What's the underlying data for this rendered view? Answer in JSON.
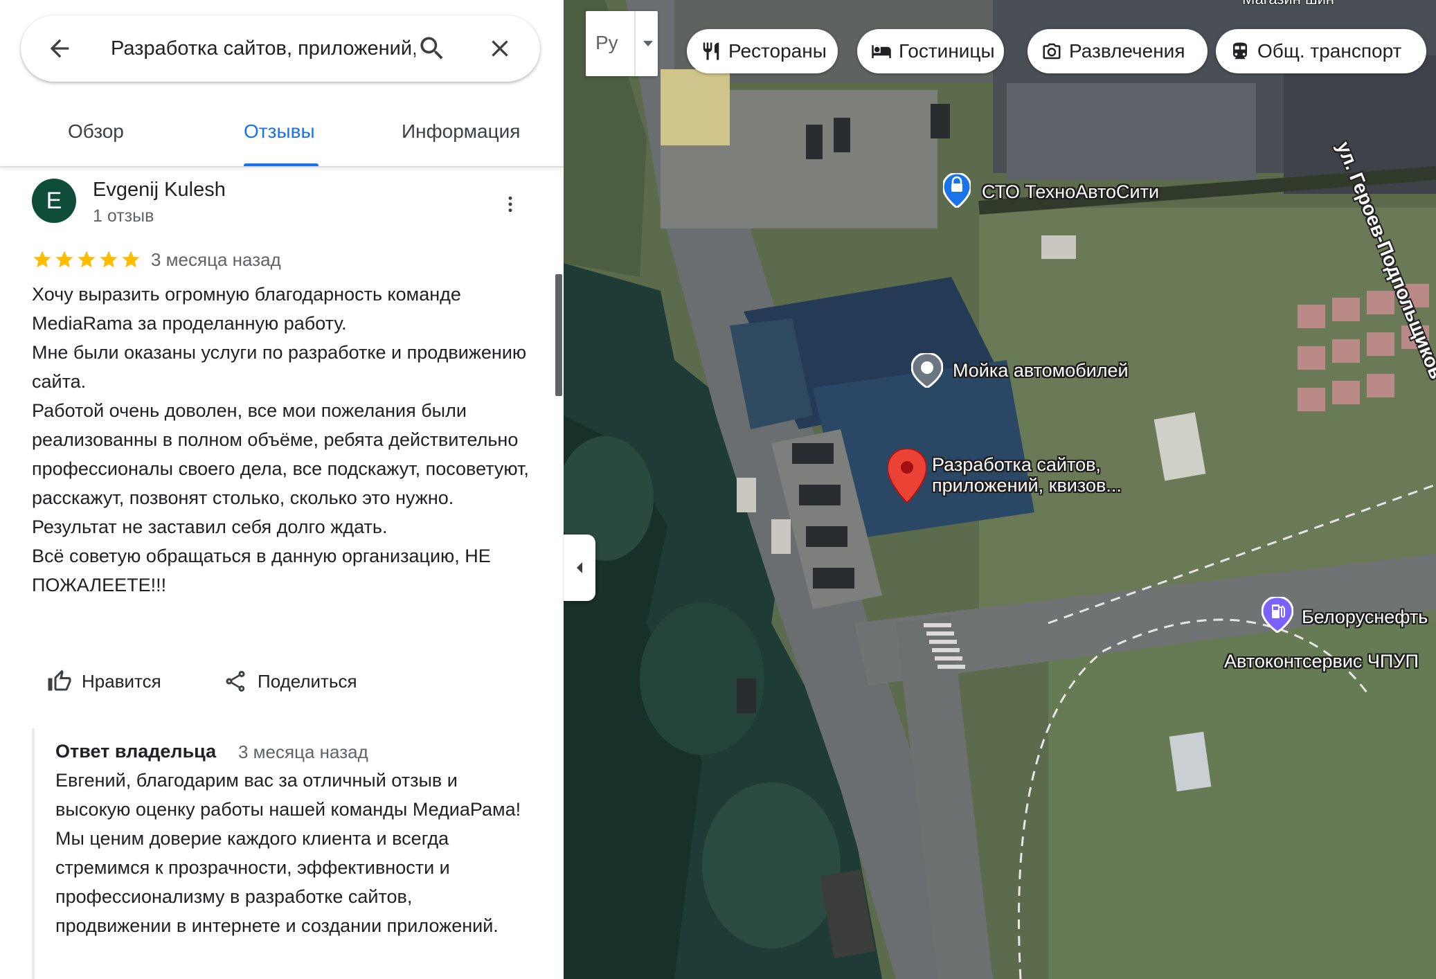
{
  "search": {
    "query": "Разработка сайтов, приложений, квизов"
  },
  "tabs": [
    {
      "label": "Обзор"
    },
    {
      "label": "Отзывы"
    },
    {
      "label": "Информация"
    }
  ],
  "review": {
    "avatar_letter": "E",
    "author": "Evgenij Kulesh",
    "author_sub": "1 отзыв",
    "rating": 5,
    "date": "3 месяца назад",
    "text_lines": [
      "Хочу выразить огромную благодарность команде MediaRama за проделанную работу.",
      "Мне были оказаны услуги по разработке и продвижению сайта.",
      "Работой очень доволен, все мои пожелания были реализованны в полном объёме, ребята действительно профессионалы своего дела, все подскажут, посоветуют, расскажут, позвонят столько, сколько это нужно.",
      "Результат не заставил себя долго ждать.",
      "Всё советую обращаться в данную организацию, НЕ ПОЖАЛЕЕТЕ!!!"
    ],
    "like_label": "Нравится",
    "share_label": "Поделиться"
  },
  "owner_response": {
    "title": "Ответ владельца",
    "date": "3 месяца назад",
    "text": "Евгений, благодарим вас за отличный отзыв и высокую оценку работы нашей команды МедиаРама! Мы ценим доверие каждого клиента и всегда стремимся к прозрачности, эффективности и профессионализму в разработке сайтов, продвижении в интернете и создании приложений."
  },
  "map": {
    "language_button": "Ру",
    "chips": [
      {
        "label": "Рестораны",
        "icon": "fork-knife-icon"
      },
      {
        "label": "Гостиницы",
        "icon": "bed-icon"
      },
      {
        "label": "Развлечения",
        "icon": "camera-icon"
      },
      {
        "label": "Общ. транспорт",
        "icon": "bus-icon"
      }
    ],
    "street": "ул. Героев-Подпольщиков",
    "top_label": "Магазин шин",
    "places": [
      {
        "name": "СТО ТехноАвтоСити",
        "icon": "car-service-icon"
      },
      {
        "name": "Мойка автомобилей",
        "icon": "location-dot-icon"
      },
      {
        "name_line1": "Разработка сайтов,",
        "name_line2": "приложений, квизов...",
        "icon": "red-pin-icon"
      },
      {
        "name": "Белоруснефть",
        "icon": "fuel-icon"
      },
      {
        "name": "Автоконтсервис ЧПУП"
      }
    ],
    "accent_color": "#1a73e8",
    "pin_color": "#ea4335"
  }
}
